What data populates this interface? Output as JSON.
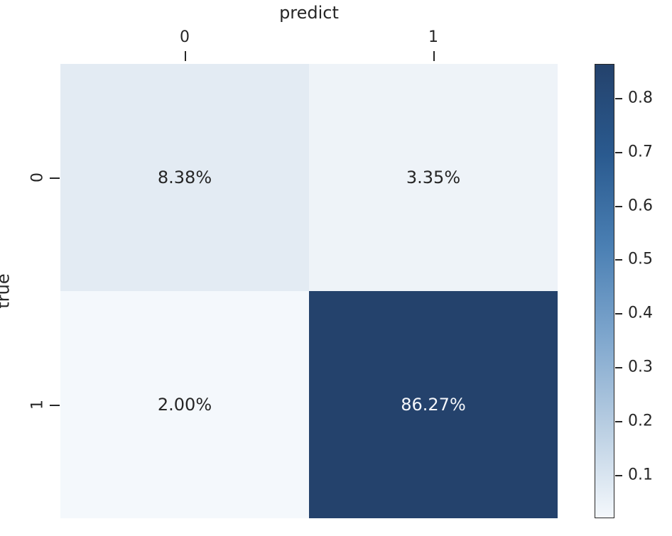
{
  "chart_data": {
    "type": "heatmap",
    "xlabel": "predict",
    "ylabel": "true",
    "x_categories": [
      "0",
      "1"
    ],
    "y_categories": [
      "0",
      "1"
    ],
    "values": [
      [
        0.0838,
        0.0335
      ],
      [
        0.02,
        0.8627
      ]
    ],
    "annotations": [
      [
        "8.38%",
        "3.35%"
      ],
      [
        "2.00%",
        "86.27%"
      ]
    ],
    "cell_colors": [
      [
        "#e3ebf3",
        "#eef3f8"
      ],
      [
        "#f4f8fc",
        "#24426c"
      ]
    ],
    "text_is_light": [
      [
        false,
        false
      ],
      [
        false,
        true
      ]
    ],
    "colorbar": {
      "vmin": 0.02,
      "vmax": 0.8627,
      "ticks": [
        0.1,
        0.2,
        0.3,
        0.4,
        0.5,
        0.6,
        0.7,
        0.8
      ],
      "tick_labels": [
        "0.1",
        "0.2",
        "0.3",
        "0.4",
        "0.5",
        "0.6",
        "0.7",
        "0.8"
      ],
      "gradient_stops": [
        {
          "pct": 0,
          "color": "#24426c"
        },
        {
          "pct": 20,
          "color": "#2a5a8f"
        },
        {
          "pct": 40,
          "color": "#4a7fb3"
        },
        {
          "pct": 60,
          "color": "#7ea6cd"
        },
        {
          "pct": 80,
          "color": "#b9cee2"
        },
        {
          "pct": 100,
          "color": "#f4f8fc"
        }
      ]
    }
  }
}
